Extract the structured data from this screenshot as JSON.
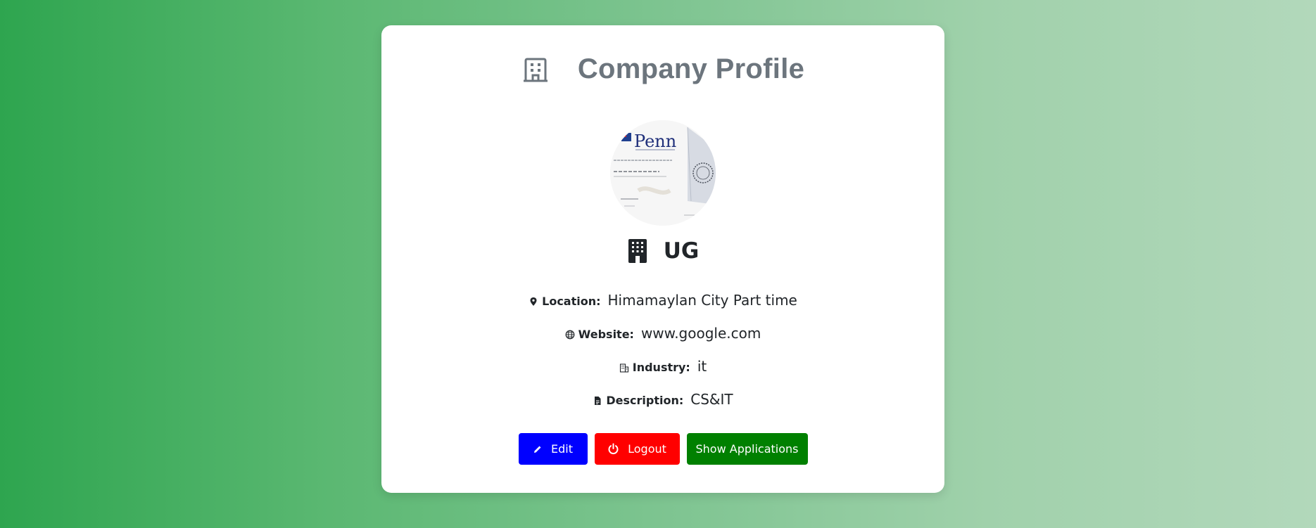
{
  "header": {
    "title": "Company Profile",
    "icon": "building-icon"
  },
  "company": {
    "avatar_alt": "Company logo",
    "logo_text": "Penn",
    "name": "UG"
  },
  "details": [
    {
      "label": "Location:",
      "value": "Himamaylan City Part time",
      "icon": "location-pin-icon"
    },
    {
      "label": "Website:",
      "value": "www.google.com",
      "icon": "globe-icon"
    },
    {
      "label": "Industry:",
      "value": "it",
      "icon": "buildings-icon"
    },
    {
      "label": "Description:",
      "value": "CS&IT",
      "icon": "document-icon"
    }
  ],
  "actions": {
    "edit_label": "Edit",
    "logout_label": "Logout",
    "applications_label": "Show Applications"
  },
  "colors": {
    "edit": "#0000ff",
    "logout": "#ff0000",
    "applications": "#008000",
    "title": "#6c757d"
  }
}
